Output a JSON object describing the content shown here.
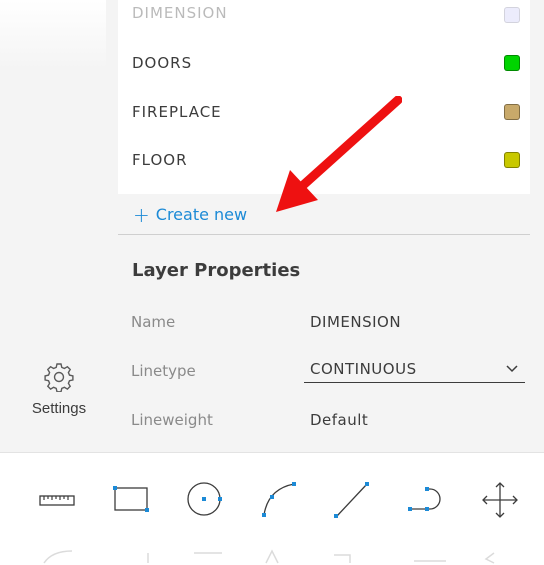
{
  "sidebar": {
    "settings_label": "Settings",
    "settings_icon": "gear-icon"
  },
  "layers": {
    "items": [
      {
        "name": "DIMENSION",
        "color": "#c9c9f7"
      },
      {
        "name": "DOORS",
        "color": "#00d400"
      },
      {
        "name": "FIREPLACE",
        "color": "#c8a96a"
      },
      {
        "name": "FLOOR",
        "color": "#c8c800"
      }
    ],
    "create_new_label": "Create new"
  },
  "properties": {
    "title": "Layer Properties",
    "name_label": "Name",
    "name_value": "DIMENSION",
    "linetype_label": "Linetype",
    "linetype_value": "CONTINUOUS",
    "lineweight_label": "Lineweight",
    "lineweight_value": "Default"
  },
  "toolbar": {
    "tools": [
      "ruler-icon",
      "rectangle-icon",
      "circle-icon",
      "arc-icon",
      "line-icon",
      "polyline-icon",
      "move-icon"
    ]
  },
  "annotation": {
    "arrow_color": "#ee1111"
  }
}
